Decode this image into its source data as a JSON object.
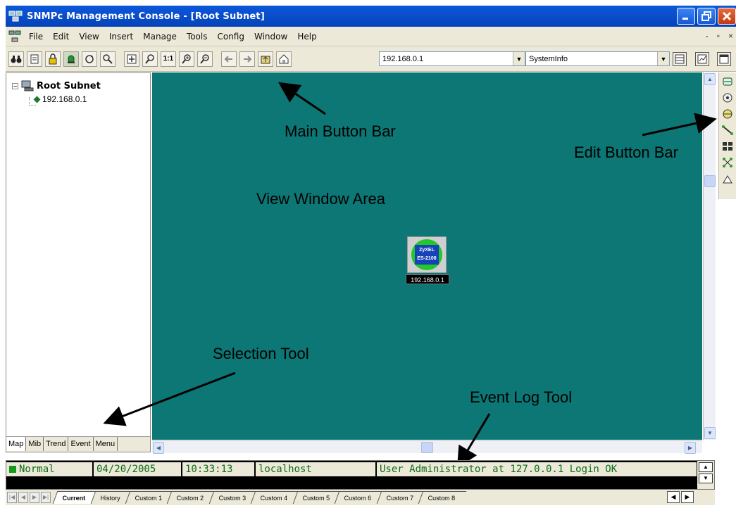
{
  "window": {
    "title": "SNMPc Management Console - [Root Subnet]"
  },
  "menu": {
    "items": [
      "File",
      "Edit",
      "View",
      "Insert",
      "Manage",
      "Tools",
      "Config",
      "Window",
      "Help"
    ],
    "mdi_minimize": "-",
    "mdi_restore": "▫",
    "mdi_close": "×"
  },
  "toolbar": {
    "address_value": "192.168.0.1",
    "info_value": "SystemInfo",
    "zoom_1to1": "1:1"
  },
  "tree": {
    "root_label": "Root Subnet",
    "child_label": "192.168.0.1"
  },
  "left_tabs": [
    "Map",
    "Mib",
    "Trend",
    "Event",
    "Menu"
  ],
  "device": {
    "screen_line1": "ZyXEL",
    "screen_line2": "ES-2108",
    "label": "192.168.0.1"
  },
  "annotations": {
    "main_button_bar": "Main Button Bar",
    "edit_button_bar": "Edit Button Bar",
    "view_window_area": "View Window Area",
    "selection_tool": "Selection Tool",
    "event_log_tool": "Event Log Tool"
  },
  "event_log": {
    "severity": "Normal",
    "date": "04/20/2005",
    "time": "10:33:13",
    "host": "localhost",
    "message": "User Administrator at 127.0.0.1 Login OK"
  },
  "bottom_tabs": [
    "Current",
    "History",
    "Custom 1",
    "Custom 2",
    "Custom 3",
    "Custom 4",
    "Custom 5",
    "Custom 6",
    "Custom 7",
    "Custom 8"
  ],
  "colors": {
    "title_bar": "#0a58d8",
    "view_background": "#0c7775",
    "log_text": "#0c6b14"
  }
}
